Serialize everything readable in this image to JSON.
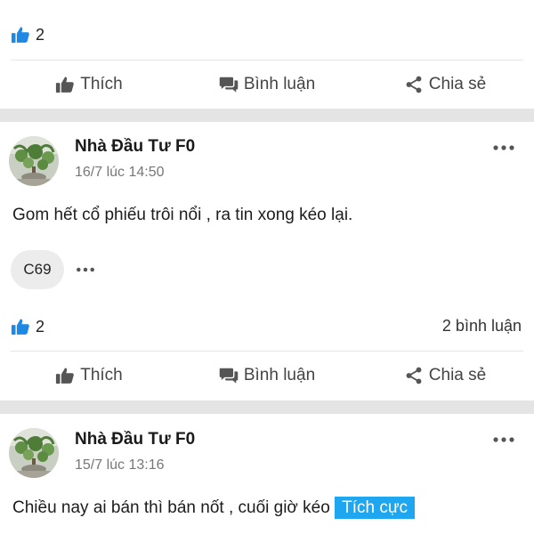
{
  "colors": {
    "accent": "#1ea7f0",
    "like_blue": "#1e88e5",
    "separator": "#e4e4e4"
  },
  "top_post": {
    "likes": "2",
    "actions": {
      "like": "Thích",
      "comment": "Bình luận",
      "share": "Chia sẻ"
    }
  },
  "post1": {
    "author": "Nhà Đầu Tư F0",
    "time": "16/7 lúc 14:50",
    "content": "Gom hết cổ phiếu trôi nổi , ra tin xong kéo lại.",
    "stock_tag": "C69",
    "likes": "2",
    "comments": "2 bình luận",
    "actions": {
      "like": "Thích",
      "comment": "Bình luận",
      "share": "Chia sẻ"
    }
  },
  "post2": {
    "author": "Nhà Đầu Tư F0",
    "time": "15/7 lúc 13:16",
    "content": "Chiều nay ai bán thì bán nốt , cuối giờ kéo",
    "sentiment": "Tích cực"
  },
  "icons": {
    "like": "thumbs-up-icon",
    "comment": "comment-icon",
    "share": "share-icon",
    "more": "more-icon"
  }
}
